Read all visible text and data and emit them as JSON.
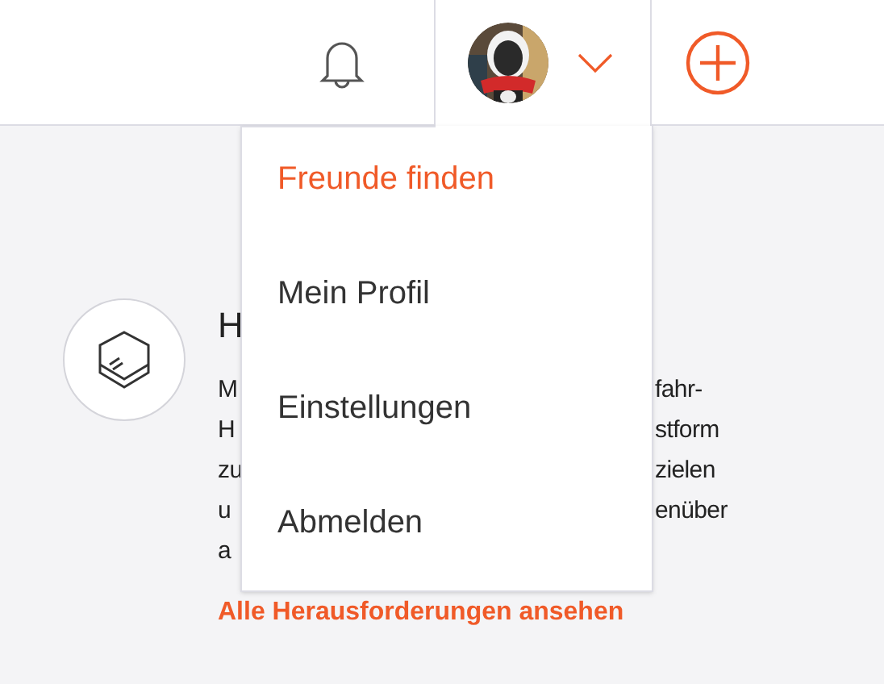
{
  "header": {
    "profile": {
      "expanded": true
    }
  },
  "challenge": {
    "title": "H",
    "lines": [
      {
        "left": "M",
        "right": "fahr-"
      },
      {
        "left": "H",
        "right": "stform"
      },
      {
        "left": "zu",
        "right": "zielen"
      },
      {
        "left": "u",
        "right": "enüber"
      },
      {
        "left": "a"
      }
    ],
    "link": "Alle Herausforderungen ansehen"
  },
  "menu": [
    {
      "label": "Freunde finden",
      "selected": true
    },
    {
      "label": "Mein Profil",
      "selected": false
    },
    {
      "label": "Einstellungen",
      "selected": false
    },
    {
      "label": "Abmelden",
      "selected": false
    }
  ]
}
